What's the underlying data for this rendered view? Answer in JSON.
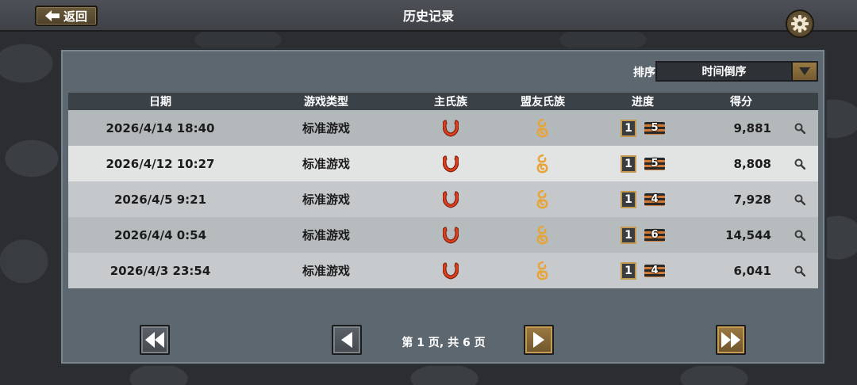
{
  "header": {
    "back_label": "返回",
    "title": "历史记录"
  },
  "sort": {
    "label": "排序:",
    "value": "时间倒序"
  },
  "table": {
    "columns": [
      "日期",
      "游戏类型",
      "主氏族",
      "盟友氏族",
      "进度",
      "得分"
    ],
    "rows": [
      {
        "date": "2026/4/14 18:40",
        "type": "标准游戏",
        "main_clan_icon": "red-horseshoe-icon",
        "ally_clan_icon": "gold-swirl-icon",
        "progress_a": "1",
        "progress_b": "5",
        "score": "9,881"
      },
      {
        "date": "2026/4/12 10:27",
        "type": "标准游戏",
        "main_clan_icon": "red-horseshoe-icon",
        "ally_clan_icon": "gold-swirl-icon",
        "progress_a": "1",
        "progress_b": "5",
        "score": "8,808"
      },
      {
        "date": "2026/4/5 9:21",
        "type": "标准游戏",
        "main_clan_icon": "red-horseshoe-icon",
        "ally_clan_icon": "gold-swirl-icon",
        "progress_a": "1",
        "progress_b": "4",
        "score": "7,928"
      },
      {
        "date": "2026/4/4 0:54",
        "type": "标准游戏",
        "main_clan_icon": "red-horseshoe-icon",
        "ally_clan_icon": "gold-swirl-icon",
        "progress_a": "1",
        "progress_b": "6",
        "score": "14,544"
      },
      {
        "date": "2026/4/3 23:54",
        "type": "标准游戏",
        "main_clan_icon": "red-horseshoe-icon",
        "ally_clan_icon": "gold-swirl-icon",
        "progress_a": "1",
        "progress_b": "4",
        "score": "6,041"
      }
    ]
  },
  "pagination": {
    "info": "第 1 页, 共 6 页"
  },
  "colors": {
    "main_clan": "#d8401e",
    "ally_clan": "#e7a43a",
    "accent_gold": "#9c7a42"
  }
}
